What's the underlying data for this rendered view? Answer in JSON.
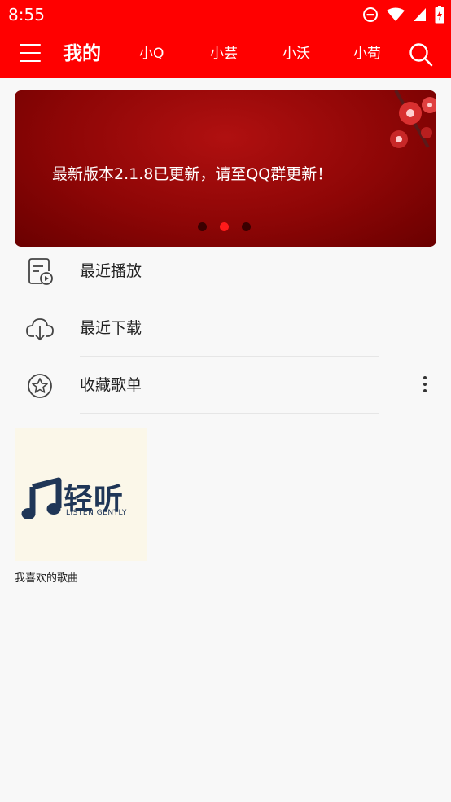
{
  "status_bar": {
    "time": "8:55",
    "icons": [
      "dnd-icon",
      "wifi-icon",
      "signal-icon",
      "battery-icon"
    ]
  },
  "header": {
    "tabs": [
      {
        "label": "我的",
        "active": true
      },
      {
        "label": "小Q"
      },
      {
        "label": "小芸"
      },
      {
        "label": "小沃"
      },
      {
        "label": "小苟"
      }
    ],
    "icons": {
      "menu": "menu-icon",
      "search": "search-icon"
    },
    "color": "#ff0000"
  },
  "banner": {
    "text": "最新版本2.1.8已更新，请至QQ群更新！",
    "slide_count": 3,
    "active_slide": 2
  },
  "menu_items": [
    {
      "label": "最近播放",
      "icon": "recent-play-icon"
    },
    {
      "label": "最近下载",
      "icon": "cloud-download-icon"
    },
    {
      "label": "收藏歌单",
      "icon": "star-icon"
    }
  ],
  "playlists": [
    {
      "title": "我喜欢的歌曲",
      "cover": {
        "title": "轻听",
        "subtitle": "LISTEN GENTLY"
      }
    }
  ]
}
